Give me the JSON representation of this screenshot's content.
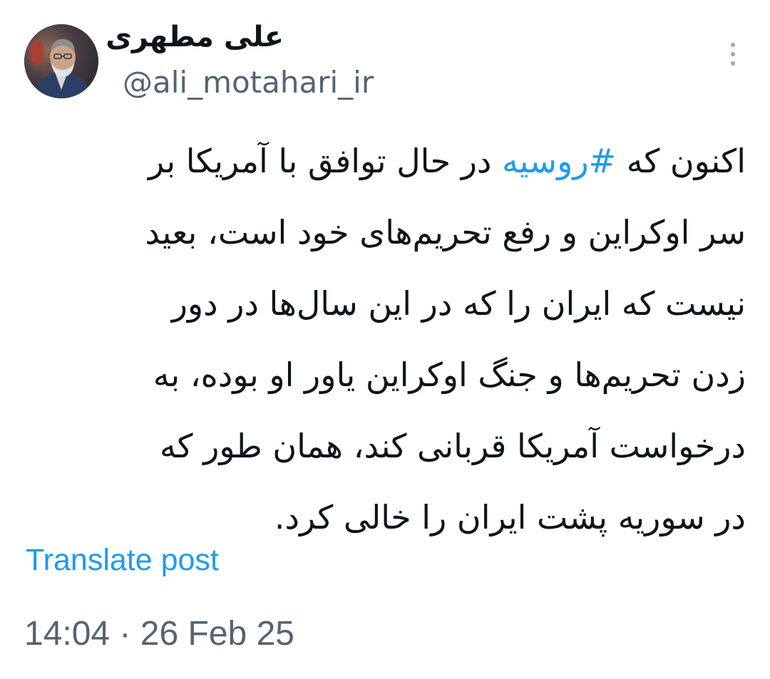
{
  "author": {
    "display_name": "علی مطهری",
    "handle": "@ali_motahari_ir"
  },
  "menu": {
    "icon": "more-vertical-icon"
  },
  "post": {
    "lines": [
      [
        "اکنون که ",
        "#روسیه",
        " در حال توافق با آمریکا بر"
      ],
      [
        "سر اوکراین و رفع تحریم‌های خود است، بعید"
      ],
      [
        "نیست که ایران را که در این سال‌ها در دور"
      ],
      [
        "زدن تحریم‌ها و جنگ اوکراین یاور او بوده، به"
      ],
      [
        "درخواست آمریکا قربانی کند، همان طور که"
      ],
      [
        "در سوریه پشت ایران را خالی کرد."
      ]
    ],
    "translate_label": "Translate post"
  },
  "meta": {
    "time": "14:04",
    "separator": "·",
    "date": "26 Feb 25"
  },
  "colors": {
    "link": "#1d9bf0",
    "secondary_text": "#536471",
    "primary_text": "#0f1419"
  }
}
